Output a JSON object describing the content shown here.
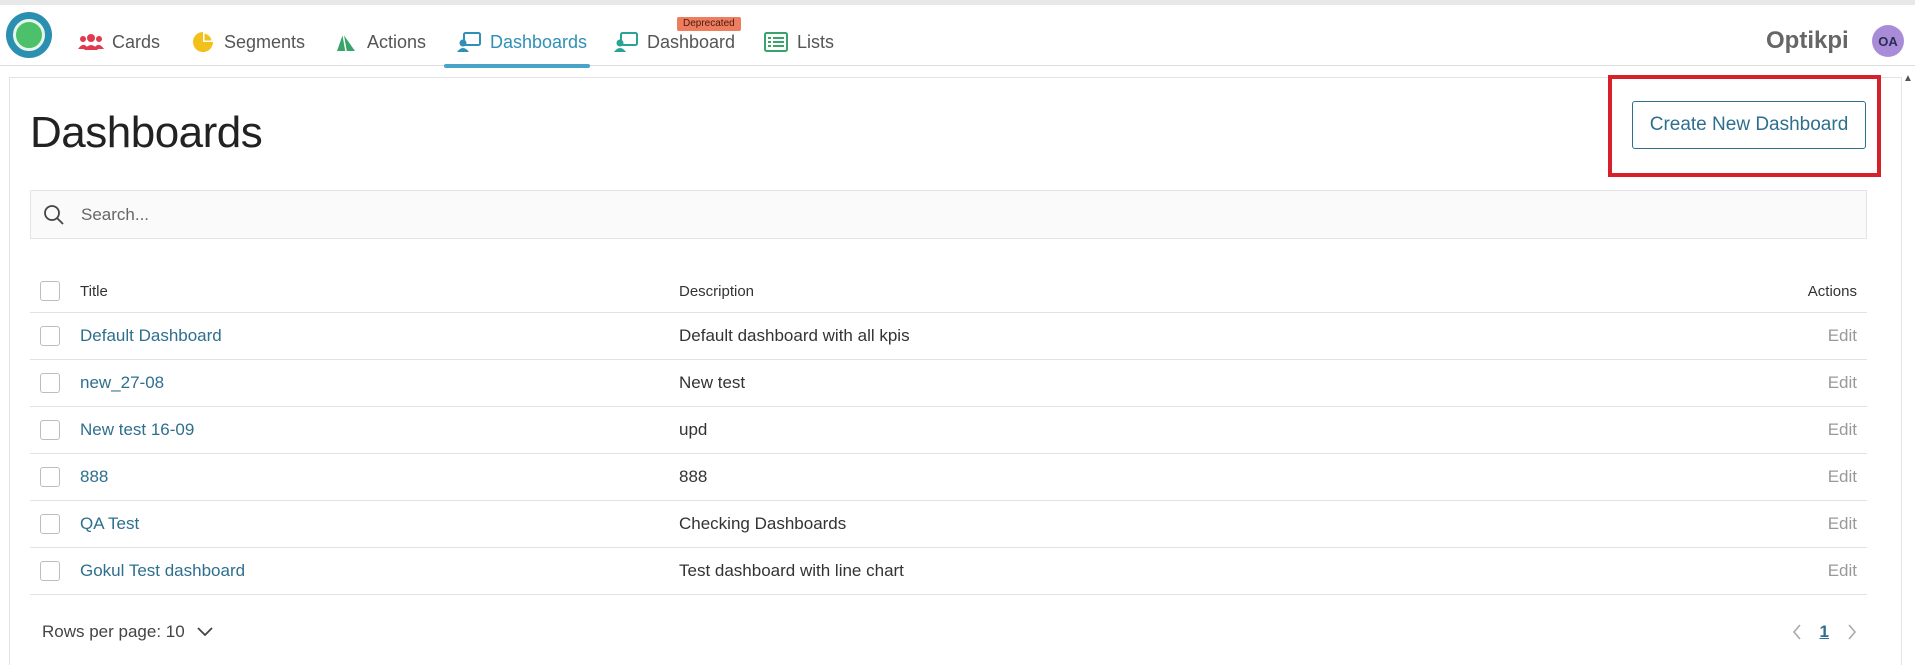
{
  "nav": {
    "items": [
      {
        "label": "Cards",
        "icon": "users-icon",
        "color": "#e03a4e"
      },
      {
        "label": "Segments",
        "icon": "pie-chart-icon",
        "color": "#f2c01a"
      },
      {
        "label": "Actions",
        "icon": "sail-icon",
        "color": "#3aa36a"
      },
      {
        "label": "Dashboards",
        "icon": "dashboard-icon",
        "color": "#2f8fb5",
        "active": true
      },
      {
        "label": "Dashboard",
        "icon": "dashboard-icon",
        "color": "#2aa396",
        "badge": "Deprecated"
      },
      {
        "label": "Lists",
        "icon": "list-icon",
        "color": "#3aa36a"
      }
    ],
    "brand": "Optikpi",
    "avatar_initials": "OA"
  },
  "page": {
    "title": "Dashboards",
    "create_button": "Create New Dashboard"
  },
  "search": {
    "placeholder": "Search..."
  },
  "table": {
    "columns": {
      "title": "Title",
      "description": "Description",
      "actions": "Actions"
    },
    "rows": [
      {
        "title": "Default Dashboard",
        "description": "Default dashboard with all kpis",
        "action": "Edit"
      },
      {
        "title": "new_27-08",
        "description": "New test",
        "action": "Edit"
      },
      {
        "title": "New test 16-09",
        "description": "upd",
        "action": "Edit"
      },
      {
        "title": "888",
        "description": "888",
        "action": "Edit"
      },
      {
        "title": "QA Test",
        "description": "Checking Dashboards",
        "action": "Edit"
      },
      {
        "title": "Gokul Test dashboard",
        "description": "Test dashboard with line chart",
        "action": "Edit"
      }
    ]
  },
  "pagination": {
    "rows_per_page_label": "Rows per page: 10",
    "current_page": "1"
  }
}
